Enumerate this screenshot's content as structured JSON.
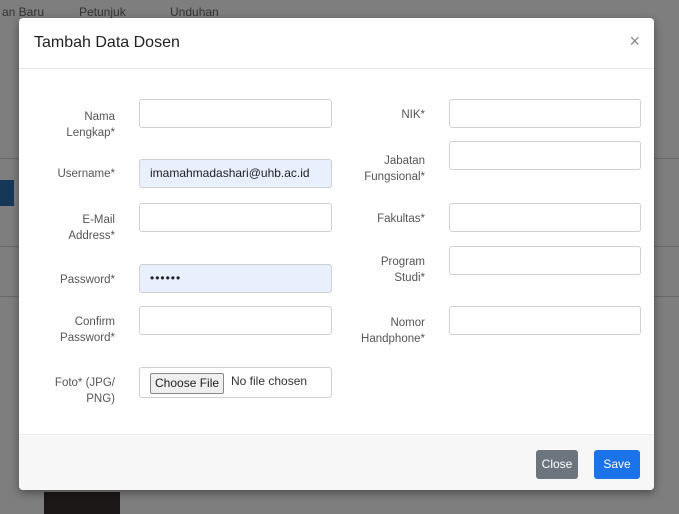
{
  "background": {
    "topbar": [
      "an Baru",
      "Petunjuk",
      "Unduhan"
    ]
  },
  "modal": {
    "title": "Tambah Data Dosen",
    "close_glyph": "×",
    "left_fields": [
      {
        "label_lines": [
          "Nama",
          "Lengkap*"
        ],
        "value": "",
        "type": "text"
      },
      {
        "label_lines": [
          "Username*"
        ],
        "value": "imamahmadashari@uhb.ac.id",
        "type": "text"
      },
      {
        "label_lines": [
          "E-Mail",
          "Address*"
        ],
        "value": "",
        "type": "text"
      },
      {
        "label_lines": [
          "Password*"
        ],
        "value": "••••••",
        "type": "password"
      },
      {
        "label_lines": [
          "Confirm",
          "Password*"
        ],
        "value": "",
        "type": "password"
      }
    ],
    "right_fields": [
      {
        "label_lines": [
          "NIK*"
        ],
        "value": ""
      },
      {
        "label_lines": [
          "Jabatan",
          "Fungsional*"
        ],
        "value": ""
      },
      {
        "label_lines": [
          "Fakultas*"
        ],
        "value": ""
      },
      {
        "label_lines": [
          "Program",
          "Studi*"
        ],
        "value": ""
      },
      {
        "label_lines": [
          "Nomor",
          "Handphone*"
        ],
        "value": ""
      }
    ],
    "photo": {
      "label_lines": [
        "Foto* (JPG/",
        "PNG)"
      ],
      "button": "Choose File",
      "status": "No file chosen"
    },
    "footer": {
      "close_label": "Close",
      "save_label": "Save"
    }
  },
  "colors": {
    "save_button": "#1a73e8",
    "close_button": "#6c757d",
    "autofill": "#e8effd"
  }
}
